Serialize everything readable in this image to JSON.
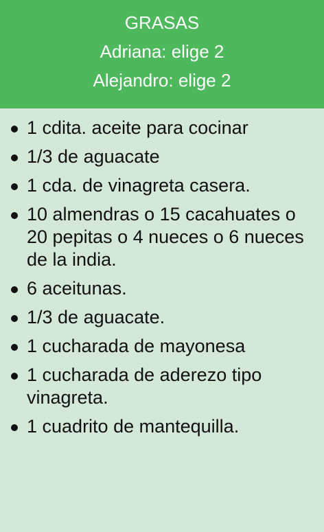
{
  "header": {
    "title": "GRASAS",
    "line1": "Adriana: elige 2",
    "line2": "Alejandro: elige 2"
  },
  "items": [
    "1 cdita. aceite para cocinar",
    "1/3 de aguacate",
    "1 cda. de vinagreta casera.",
    "10 almendras o 15 cacahuates o 20 pepitas o 4 nueces o 6 nueces de la india.",
    "6 aceitunas.",
    "1/3 de aguacate.",
    "1 cucharada de mayonesa",
    "1 cucharada de aderezo tipo vinagreta.",
    "1 cuadrito de mantequilla."
  ],
  "colors": {
    "header_bg": "#4db85c",
    "body_bg": "#d4e8d9",
    "header_text": "#ffffff",
    "body_text": "#111111"
  }
}
